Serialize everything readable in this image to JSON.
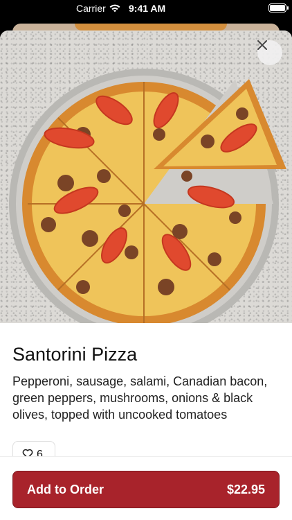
{
  "status": {
    "carrier": "Carrier",
    "time": "9:41 AM"
  },
  "item": {
    "title": "Santorini Pizza",
    "description": "Pepperoni, sausage, salami, Canadian bacon, green peppers, mushrooms, onions & black olives, topped with uncooked tomatoes",
    "likes": "6",
    "hero_image": "pizza-photo"
  },
  "footer": {
    "add_label": "Add to Order",
    "price": "$22.95"
  },
  "icons": {
    "close": "close-icon",
    "like": "heart-icon",
    "wifi": "wifi-icon",
    "battery": "battery-icon"
  },
  "colors": {
    "accent": "#a8232b",
    "text": "#111111"
  }
}
